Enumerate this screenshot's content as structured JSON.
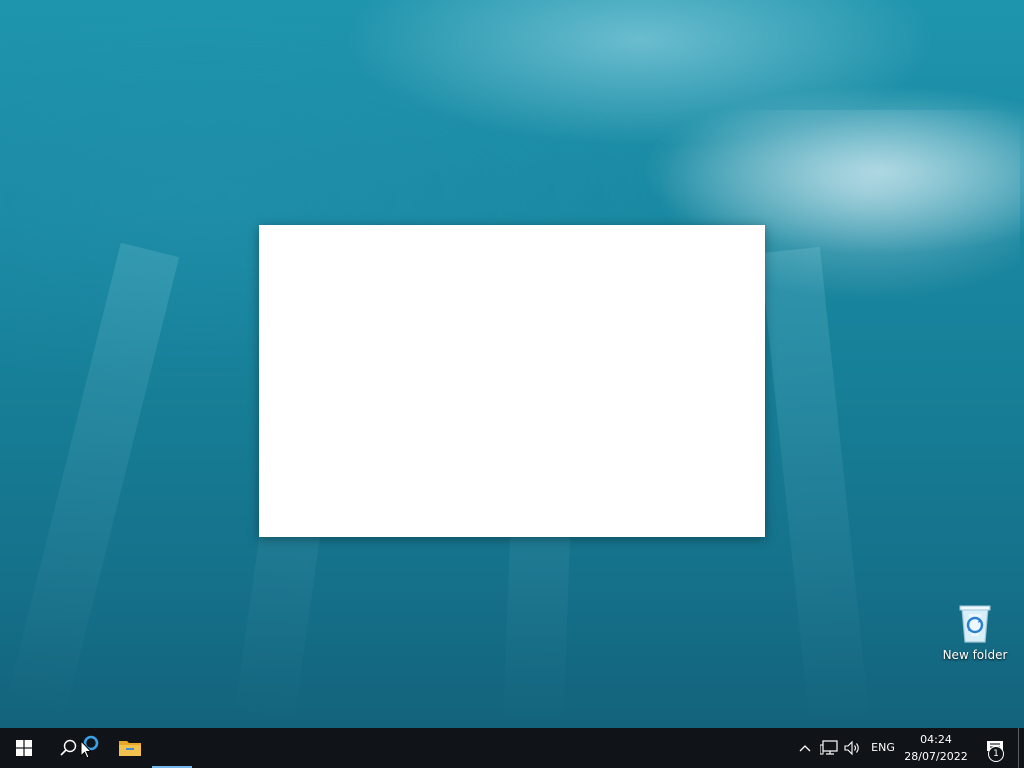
{
  "desktop": {
    "wallpaper": "underwater-ocean",
    "window": {
      "content": ""
    },
    "icons": [
      {
        "name": "recycle-bin",
        "label": "New folder"
      }
    ]
  },
  "taskbar": {
    "start_icon": "windows-logo-icon",
    "search_icon": "search-icon",
    "cortana_icon": "cortana-icon",
    "pinned": [
      {
        "name": "file-explorer",
        "icon": "folder-icon"
      }
    ],
    "tray": {
      "chevron_icon": "chevron-up-icon",
      "network_icon": "network-icon",
      "volume_icon": "volume-icon",
      "language": "ENG",
      "time": "04:24",
      "date": "28/07/2022",
      "notification_icon": "action-center-icon",
      "notification_count": "1"
    }
  },
  "colors": {
    "taskbar": "#101418",
    "accent": "#76b9ed",
    "cortana": "#3aa0e8",
    "folder": "#f2c14e"
  }
}
